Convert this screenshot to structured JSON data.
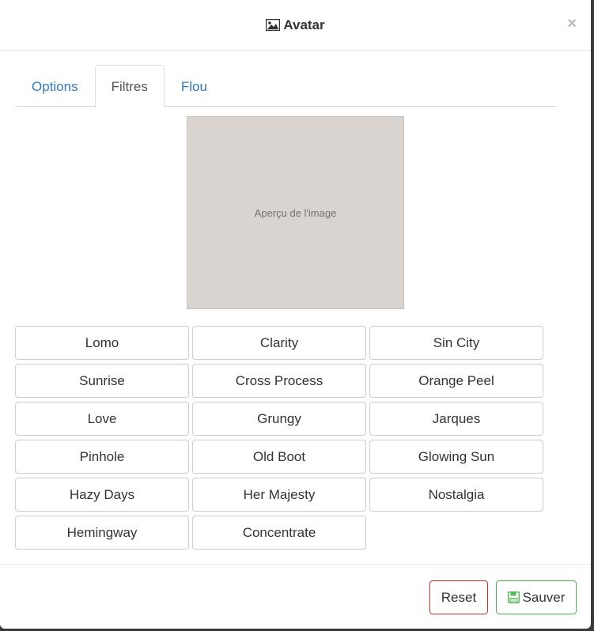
{
  "header": {
    "title": "Avatar",
    "title_icon": "image-icon",
    "close_label": "×"
  },
  "tabs": [
    {
      "label": "Options",
      "active": false
    },
    {
      "label": "Filtres",
      "active": true
    },
    {
      "label": "Flou",
      "active": false
    }
  ],
  "preview": {
    "placeholder": "Aperçu de l'image"
  },
  "filters": [
    "Lomo",
    "Clarity",
    "Sin City",
    "Sunrise",
    "Cross Process",
    "Orange Peel",
    "Love",
    "Grungy",
    "Jarques",
    "Pinhole",
    "Old Boot",
    "Glowing Sun",
    "Hazy Days",
    "Her Majesty",
    "Nostalgia",
    "Hemingway",
    "Concentrate"
  ],
  "footer": {
    "reset_label": "Reset",
    "save_label": "Sauver",
    "save_icon": "floppy-disk-icon"
  },
  "colors": {
    "link": "#337ab7",
    "danger_border": "#c9302c",
    "success_border": "#4cae4c"
  }
}
